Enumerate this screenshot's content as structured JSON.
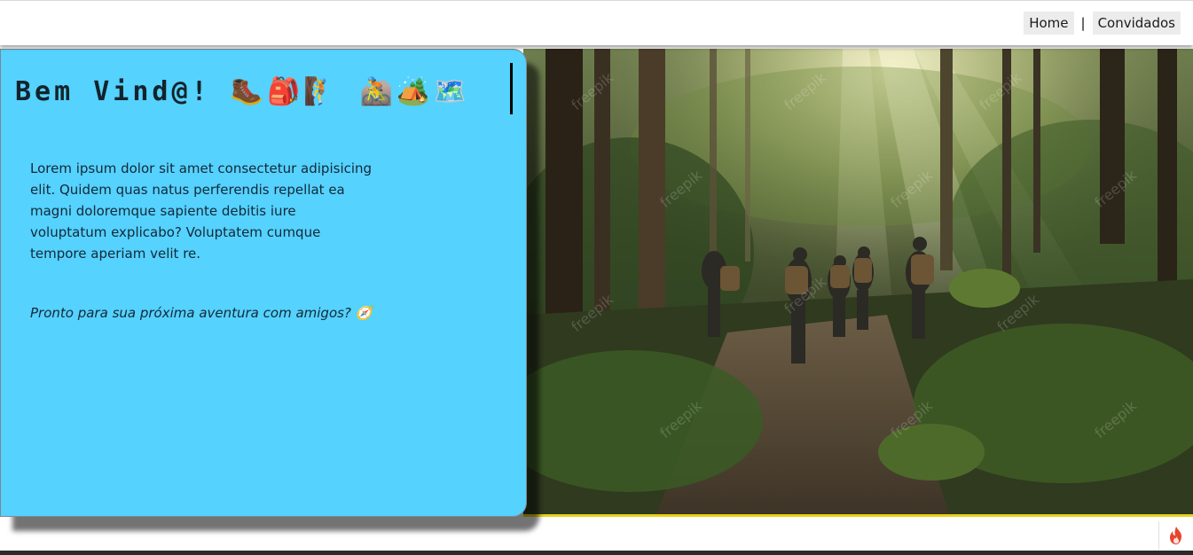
{
  "nav": {
    "home_label": "Home",
    "separator": "|",
    "guests_label": "Convidados"
  },
  "card": {
    "title": "Bem Vind@! 🥾🎒🧗 🚵🏕️🗺️",
    "body": "Lorem ipsum dolor sit amet consectetur adipisicing elit. Quidem quas natus perferendis repellat ea magni doloremque sapiente debitis iure voluptatum explicabo? Voluptatem cumque tempore aperiam velit re.",
    "tagline": "Pronto para sua próxima aventura com amigos? 🧭"
  },
  "hero": {
    "description_icon": "forest-hikers-photo",
    "watermark": "freepik"
  },
  "footer": {
    "badge_icon": "fire-icon"
  },
  "colors": {
    "card_background": "#55d2fd",
    "hero_border": "#e8d21a",
    "fire": "#e8452c"
  }
}
